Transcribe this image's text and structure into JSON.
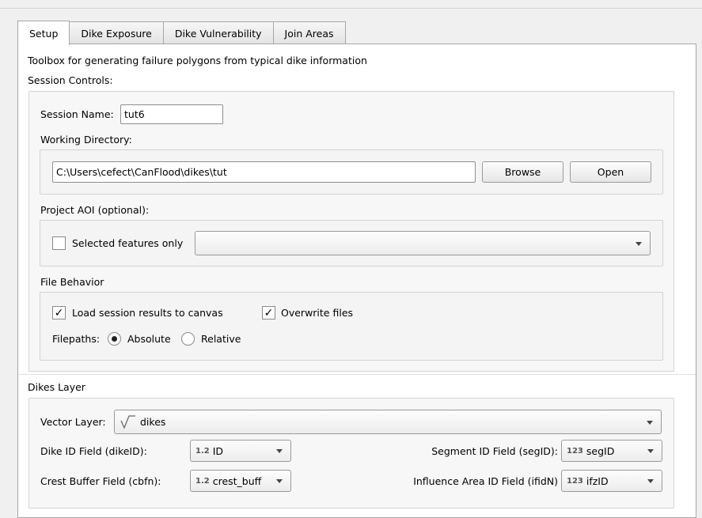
{
  "tabs": [
    {
      "label": "Setup",
      "active": true
    },
    {
      "label": "Dike Exposure",
      "active": false
    },
    {
      "label": "Dike Vulnerability",
      "active": false
    },
    {
      "label": "Join Areas",
      "active": false
    }
  ],
  "description": "Toolbox for generating failure polygons from typical dike information",
  "session_controls": {
    "title": "Session Controls:",
    "session_name_label": "Session Name:",
    "session_name_value": "tut6",
    "working_dir_label": "Working Directory:",
    "working_dir_value": "C:\\Users\\cefect\\CanFlood\\dikes\\tut",
    "browse_label": "Browse",
    "open_label": "Open",
    "aoi_label": "Project AOI (optional):",
    "selected_features_label": "Selected features only",
    "selected_features_checked": false,
    "aoi_layer_value": ""
  },
  "file_behavior": {
    "title": "File Behavior",
    "load_results_label": "Load session results to canvas",
    "load_results_checked": true,
    "overwrite_label": "Overwrite files",
    "overwrite_checked": true,
    "filepaths_label": "Filepaths:",
    "absolute_label": "Absolute",
    "relative_label": "Relative",
    "selected_filepath": "Absolute"
  },
  "dikes_layer": {
    "title": "Dikes Layer",
    "vector_layer_label": "Vector Layer:",
    "vector_layer_value": "dikes",
    "vector_layer_icon": "line-layer-icon",
    "dike_id_label": "Dike ID Field (dikeID):",
    "dike_id_type": "1.2",
    "dike_id_value": "ID",
    "crest_buffer_label": "Crest Buffer Field (cbfn):",
    "crest_buffer_type": "1.2",
    "crest_buffer_value": "crest_buff",
    "segment_id_label": "Segment ID Field (segID):",
    "segment_id_type": "123",
    "segment_id_value": "segID",
    "influence_area_label": "Influence Area ID Field (ifidN)",
    "influence_area_type": "123",
    "influence_area_value": "ifzID"
  },
  "colors": {
    "panel_bg": "#ffffff",
    "window_bg": "#f0f0f0",
    "group_bg": "#f7f7f7",
    "border": "#a7a7a7"
  }
}
